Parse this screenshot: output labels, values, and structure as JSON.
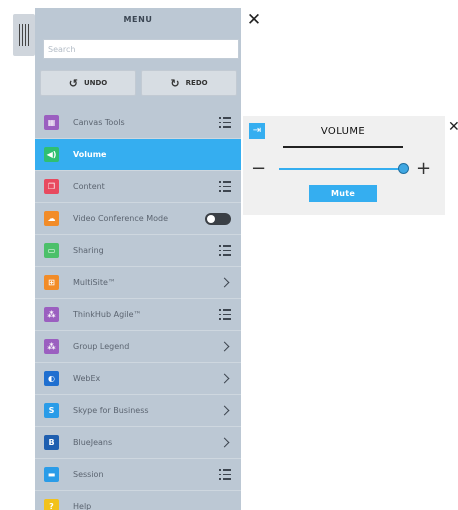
{
  "menu": {
    "title": "MENU",
    "close_glyph": "✕",
    "search": {
      "placeholder": "Search",
      "value": ""
    },
    "undo": {
      "label": "UNDO",
      "icon": "undo-icon",
      "glyph": "↺"
    },
    "redo": {
      "label": "REDO",
      "icon": "redo-icon",
      "glyph": "↻"
    },
    "items": [
      {
        "label": "Canvas Tools",
        "icon": "canvas-tools-icon",
        "color": "#9b5fc0",
        "glyph": "▦",
        "trail": "list"
      },
      {
        "label": "Volume",
        "icon": "volume-icon",
        "color": "#2fbf71",
        "glyph": "◀)",
        "trail": "none",
        "active": true
      },
      {
        "label": "Content",
        "icon": "content-icon",
        "color": "#e84a5f",
        "glyph": "❐",
        "trail": "list"
      },
      {
        "label": "Video Conference Mode",
        "icon": "cloud-icon",
        "color": "#f28c28",
        "glyph": "☁",
        "trail": "toggle"
      },
      {
        "label": "Sharing",
        "icon": "sharing-icon",
        "color": "#4cc06a",
        "glyph": "▭",
        "trail": "list"
      },
      {
        "label": "MultiSite™",
        "icon": "multisite-icon",
        "color": "#f28c28",
        "glyph": "⊞",
        "trail": "chevron"
      },
      {
        "label": "ThinkHub Agile™",
        "icon": "agile-icon",
        "color": "#9b5fc0",
        "glyph": "⁂",
        "trail": "list"
      },
      {
        "label": "Group Legend",
        "icon": "group-legend-icon",
        "color": "#9b5fc0",
        "glyph": "⁂",
        "trail": "chevron"
      },
      {
        "label": "WebEx",
        "icon": "webex-icon",
        "color": "#1f6fd0",
        "glyph": "◐",
        "trail": "chevron"
      },
      {
        "label": "Skype for Business",
        "icon": "skype-icon",
        "color": "#2a9ce8",
        "glyph": "S",
        "trail": "chevron"
      },
      {
        "label": "BlueJeans",
        "icon": "bluejeans-icon",
        "color": "#1f5fb0",
        "glyph": "B",
        "trail": "chevron"
      },
      {
        "label": "Session",
        "icon": "session-icon",
        "color": "#2a9ce8",
        "glyph": "▬",
        "trail": "list"
      },
      {
        "label": "Help",
        "icon": "help-icon",
        "color": "#f2c21b",
        "glyph": "?",
        "trail": "none"
      }
    ]
  },
  "volume_panel": {
    "title": "VOLUME",
    "mute_label": "Mute",
    "level_fraction": 0.97,
    "minus_glyph": "−",
    "plus_glyph": "+",
    "icon_glyph": "⇥",
    "close_glyph": "✕"
  },
  "colors": {
    "accent": "#35aef0",
    "menu_bg": "#bcc8d4"
  }
}
